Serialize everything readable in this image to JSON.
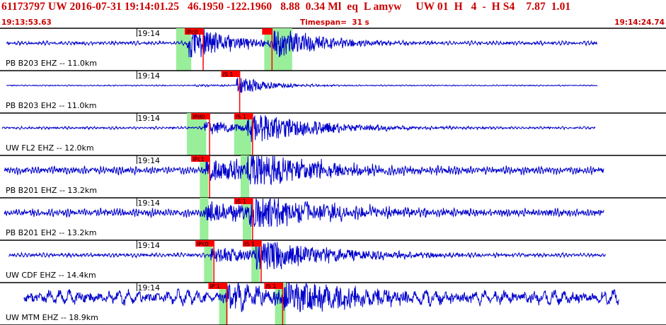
{
  "header": {
    "title": "61173797 UW 2016-07-31 19:14:01.25   46.1950 -122.1960   8.88  0.34 Ml  eq  L amyw     UW 01  H   4  -  H S4    7.87  1.01",
    "start_time": "19:13:53.63",
    "timespan": "Timespan=  31 s",
    "end_time": "19:14:24.74"
  },
  "colors": {
    "trace": "#0000cc",
    "pick": "#ff0000",
    "window": "#99ee99",
    "header_text": "#cc0000",
    "divider": "#000000"
  },
  "tick_label": "19:14",
  "panels": [
    {
      "label": "PB B203 EHZ -- 11.0km",
      "picks": [
        {
          "text": "iPc0",
          "t": 8.6
        },
        {
          "text": "",
          "t": 12.2
        }
      ],
      "windows": [
        [
          8.2,
          8.9
        ],
        [
          12.3,
          13.6
        ]
      ],
      "p_arrival": 8.7,
      "s_arrival": 12.7,
      "noise": 3,
      "p_amp": 28,
      "s_amp": 22,
      "decay": 2.0,
      "start": 0.3,
      "end": 27.8,
      "freq": 6,
      "seed": 11
    },
    {
      "label": "PB B203 EH2 -- 11.0km",
      "picks": [
        {
          "text": "iS 1",
          "t": 10.3
        }
      ],
      "windows": [],
      "p_arrival": 9.0,
      "s_arrival": 11.0,
      "noise": 1,
      "p_amp": 2,
      "s_amp": 14,
      "decay": 1.2,
      "start": 0.3,
      "end": 27.8,
      "freq": 6,
      "seed": 22
    },
    {
      "label": "UW FL2 EHZ -- 12.0km",
      "picks": [
        {
          "text": "iPd0",
          "t": 8.9
        },
        {
          "text": "iS 1",
          "t": 10.9
        }
      ],
      "windows": [
        [
          8.7,
          9.6
        ],
        [
          10.9,
          11.7
        ]
      ],
      "p_arrival": 9.5,
      "s_arrival": 11.5,
      "noise": 2,
      "p_amp": 10,
      "s_amp": 24,
      "decay": 2.5,
      "start": 0.1,
      "end": 27.7,
      "freq": 6,
      "seed": 33
    },
    {
      "label": "PB B201 EHZ -- 13.2km",
      "picks": [
        {
          "text": "iPc1",
          "t": 8.9
        }
      ],
      "windows": [
        [
          9.3,
          9.7
        ],
        [
          11.2,
          11.6
        ]
      ],
      "p_arrival": 9.5,
      "s_arrival": 11.5,
      "noise": 6,
      "p_amp": 18,
      "s_amp": 26,
      "decay": 3.0,
      "start": 0.2,
      "end": 28.1,
      "freq": 8,
      "seed": 44
    },
    {
      "label": "PB B201 EH2 -- 13.2km",
      "picks": [
        {
          "text": "iS 1",
          "t": 10.9
        }
      ],
      "windows": [
        [
          9.3,
          9.7
        ],
        [
          11.3,
          11.7
        ]
      ],
      "p_arrival": 9.5,
      "s_arrival": 11.6,
      "noise": 6,
      "p_amp": 16,
      "s_amp": 26,
      "decay": 3.0,
      "start": 0.2,
      "end": 28.1,
      "freq": 8,
      "seed": 55
    },
    {
      "label": "UW CDF EHZ -- 14.4km",
      "picks": [
        {
          "text": "iPc0",
          "t": 9.1
        },
        {
          "text": "iS 1",
          "t": 11.3
        }
      ],
      "windows": [
        [
          9.5,
          9.9
        ],
        [
          11.7,
          12.1
        ]
      ],
      "p_arrival": 9.8,
      "s_arrival": 11.9,
      "noise": 3,
      "p_amp": 12,
      "s_amp": 26,
      "decay": 2.8,
      "start": 0.4,
      "end": 28.2,
      "freq": 6,
      "seed": 66
    },
    {
      "label": "UW MTM EHZ -- 18.9km",
      "picks": [
        {
          "text": "iP 1",
          "t": 9.7
        },
        {
          "text": "iS 1",
          "t": 12.3
        }
      ],
      "windows": [
        [
          10.2,
          10.6
        ],
        [
          12.8,
          13.3
        ]
      ],
      "p_arrival": 10.5,
      "s_arrival": 13.2,
      "noise": 11,
      "p_amp": 18,
      "s_amp": 26,
      "decay": 3.0,
      "start": 1.1,
      "end": 28.8,
      "freq": 2.2,
      "seed": 77
    }
  ]
}
